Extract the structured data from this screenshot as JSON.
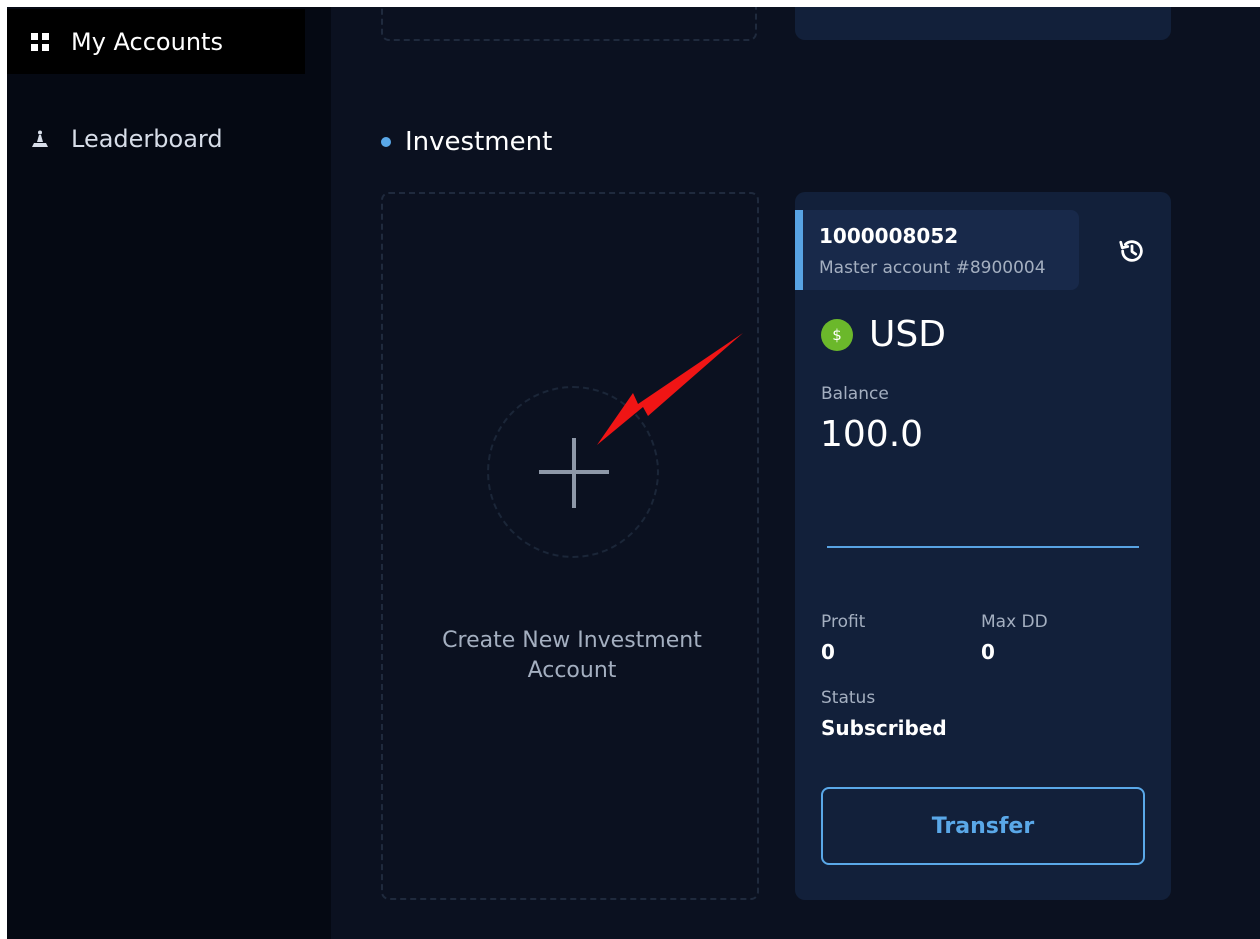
{
  "sidebar": {
    "items": [
      {
        "label": "My Accounts",
        "icon": "grid-icon",
        "active": true
      },
      {
        "label": "Leaderboard",
        "icon": "podium-icon",
        "active": false
      }
    ]
  },
  "section": {
    "title": "Investment"
  },
  "create_card": {
    "label_line1": "Create New Investment",
    "label_line2": "Account"
  },
  "account": {
    "number": "1000008052",
    "master": "Master account #8900004",
    "currency": "USD",
    "currency_symbol": "$",
    "balance_label": "Balance",
    "balance": "100.0",
    "profit_label": "Profit",
    "profit": "0",
    "maxdd_label": "Max DD",
    "maxdd": "0",
    "status_label": "Status",
    "status": "Subscribed",
    "transfer_label": "Transfer"
  },
  "colors": {
    "accent": "#58a3e3",
    "coin": "#6bb82b",
    "card": "#12203a",
    "background": "#0b1120",
    "annotation_arrow": "#f01515"
  }
}
